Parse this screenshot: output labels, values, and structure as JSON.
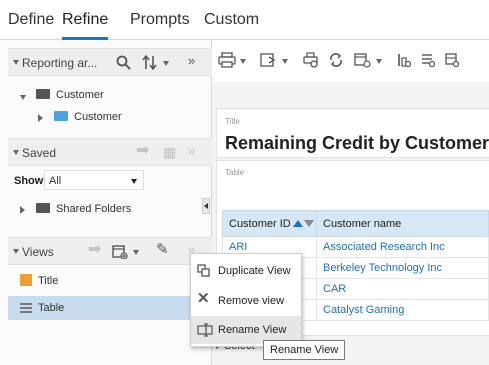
{
  "tabs": [
    {
      "label": "Define"
    },
    {
      "label": "Refine"
    },
    {
      "label": "Prompts"
    },
    {
      "label": "Custom"
    }
  ],
  "left_panel": {
    "reporting_areas": {
      "label": "Reporting ar...",
      "items": [
        {
          "label": "Customer"
        },
        {
          "label": "Customer"
        }
      ]
    },
    "saved": {
      "label": "Saved",
      "show_label": "Show",
      "show_value": "All",
      "items": [
        {
          "label": "Shared Folders"
        }
      ]
    },
    "views": {
      "label": "Views",
      "items": [
        {
          "label": "Title"
        },
        {
          "label": "Table"
        }
      ]
    }
  },
  "report": {
    "title_caption": "Title",
    "title": "Remaining Credit by Customer",
    "table_caption": "Table",
    "columns": [
      "Customer ID",
      "Customer name"
    ],
    "rows": [
      [
        "ARI",
        "Associated Research Inc"
      ],
      [
        "",
        "Berkeley Technology Inc"
      ],
      [
        "",
        "CAR"
      ],
      [
        "",
        "Catalyst Gaming"
      ]
    ],
    "selector_partial": "Select"
  },
  "context_menu": {
    "items": [
      {
        "label": "Duplicate View",
        "icon": "duplicate-icon"
      },
      {
        "label": "Remove view",
        "icon": "close-icon"
      },
      {
        "label": "Rename View",
        "icon": "rename-icon"
      }
    ]
  },
  "tooltip": "Rename View",
  "colors": {
    "accent": "#1b75bb",
    "link": "#1f6fbf",
    "selected_row": "#c7dcef",
    "header_bg": "#d6e7f5"
  }
}
